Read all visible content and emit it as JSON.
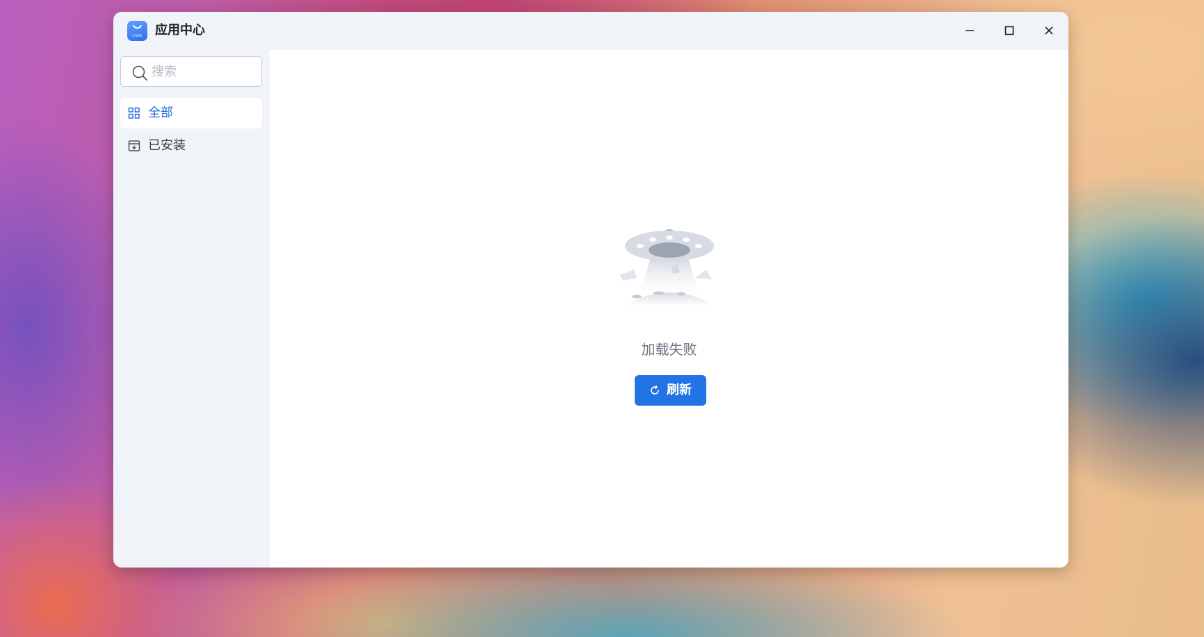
{
  "window": {
    "title": "应用中心",
    "logo_text": "STORE"
  },
  "search": {
    "placeholder": "搜索",
    "value": ""
  },
  "sidebar": {
    "items": [
      {
        "label": "全部",
        "icon": "grid-icon",
        "active": true
      },
      {
        "label": "已安装",
        "icon": "installed-box-icon",
        "active": false
      }
    ]
  },
  "main": {
    "empty_state": {
      "illustration": "ufo-icon",
      "message": "加载失败",
      "button_label": "刷新",
      "button_icon": "refresh-icon"
    }
  },
  "colors": {
    "accent": "#2273e6",
    "active_text": "#2a6fdb",
    "sidebar_bg": "#f0f3f8",
    "content_bg": "#ffffff"
  }
}
